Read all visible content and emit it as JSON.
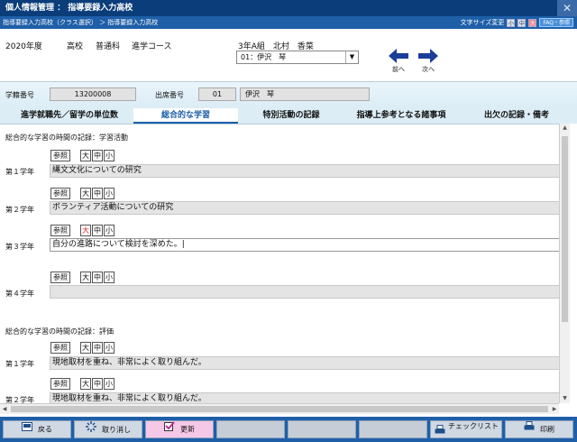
{
  "window": {
    "title": "個人情報管理 ： 指導要録入力高校",
    "breadcrumb": "指導要録入力高校（クラス選択） ＞ 指導要録入力高校",
    "font_size_label": "文字サイズ変更",
    "font_sizes": [
      "小",
      "中",
      "大"
    ],
    "faq_label": "FAQ・参照"
  },
  "header": {
    "year": "2020年度",
    "school": "高校",
    "course_type": "普通科",
    "course": "進学コース",
    "class_teacher": "3年A組　北村　香菜",
    "student_select": "01：伊沢　琴",
    "prev_label": "前へ",
    "next_label": "次へ"
  },
  "info": {
    "student_no_label": "学籍番号",
    "student_no": "13200008",
    "attendance_no_label": "出席番号",
    "attendance_no": "01",
    "name": "伊沢　琴"
  },
  "tabs": [
    "進学就職先／留学の単位数",
    "総合的な学習",
    "特別活動の記録",
    "指導上参考となる諸事項",
    "出欠の記録・備考"
  ],
  "content": {
    "section1_title": "総合的な学習の時間の記録：学習活動",
    "section2_title": "総合的な学習の時間の記録：評価",
    "ref_label": "参照",
    "size_labels": [
      "大",
      "中",
      "小"
    ],
    "rows1": [
      {
        "label": "第１学年",
        "text": "縄文文化についての研究"
      },
      {
        "label": "第２学年",
        "text": "ボランティア活動についての研究"
      },
      {
        "label": "第３学年",
        "text": "自分の進路について検討を深めた。|"
      },
      {
        "label": "第４学年",
        "text": ""
      }
    ],
    "rows2": [
      {
        "label": "第１学年",
        "text": "現地取材を重ね、非常によく取り組んだ。"
      },
      {
        "label": "第２学年",
        "text": "現地取材を重ね、非常によく取り組んだ。"
      }
    ]
  },
  "footer": {
    "back": "戻る",
    "cancel": "取り消し",
    "update": "更新",
    "checklist": "チェックリスト",
    "print": "印刷"
  },
  "colors": {
    "titlebar": "#0a3d7a",
    "crumbbar": "#1e5fa8",
    "footer": "#1e5fa8",
    "active_tab": "#1a5fa8",
    "update_button": "#f6c8e8"
  }
}
